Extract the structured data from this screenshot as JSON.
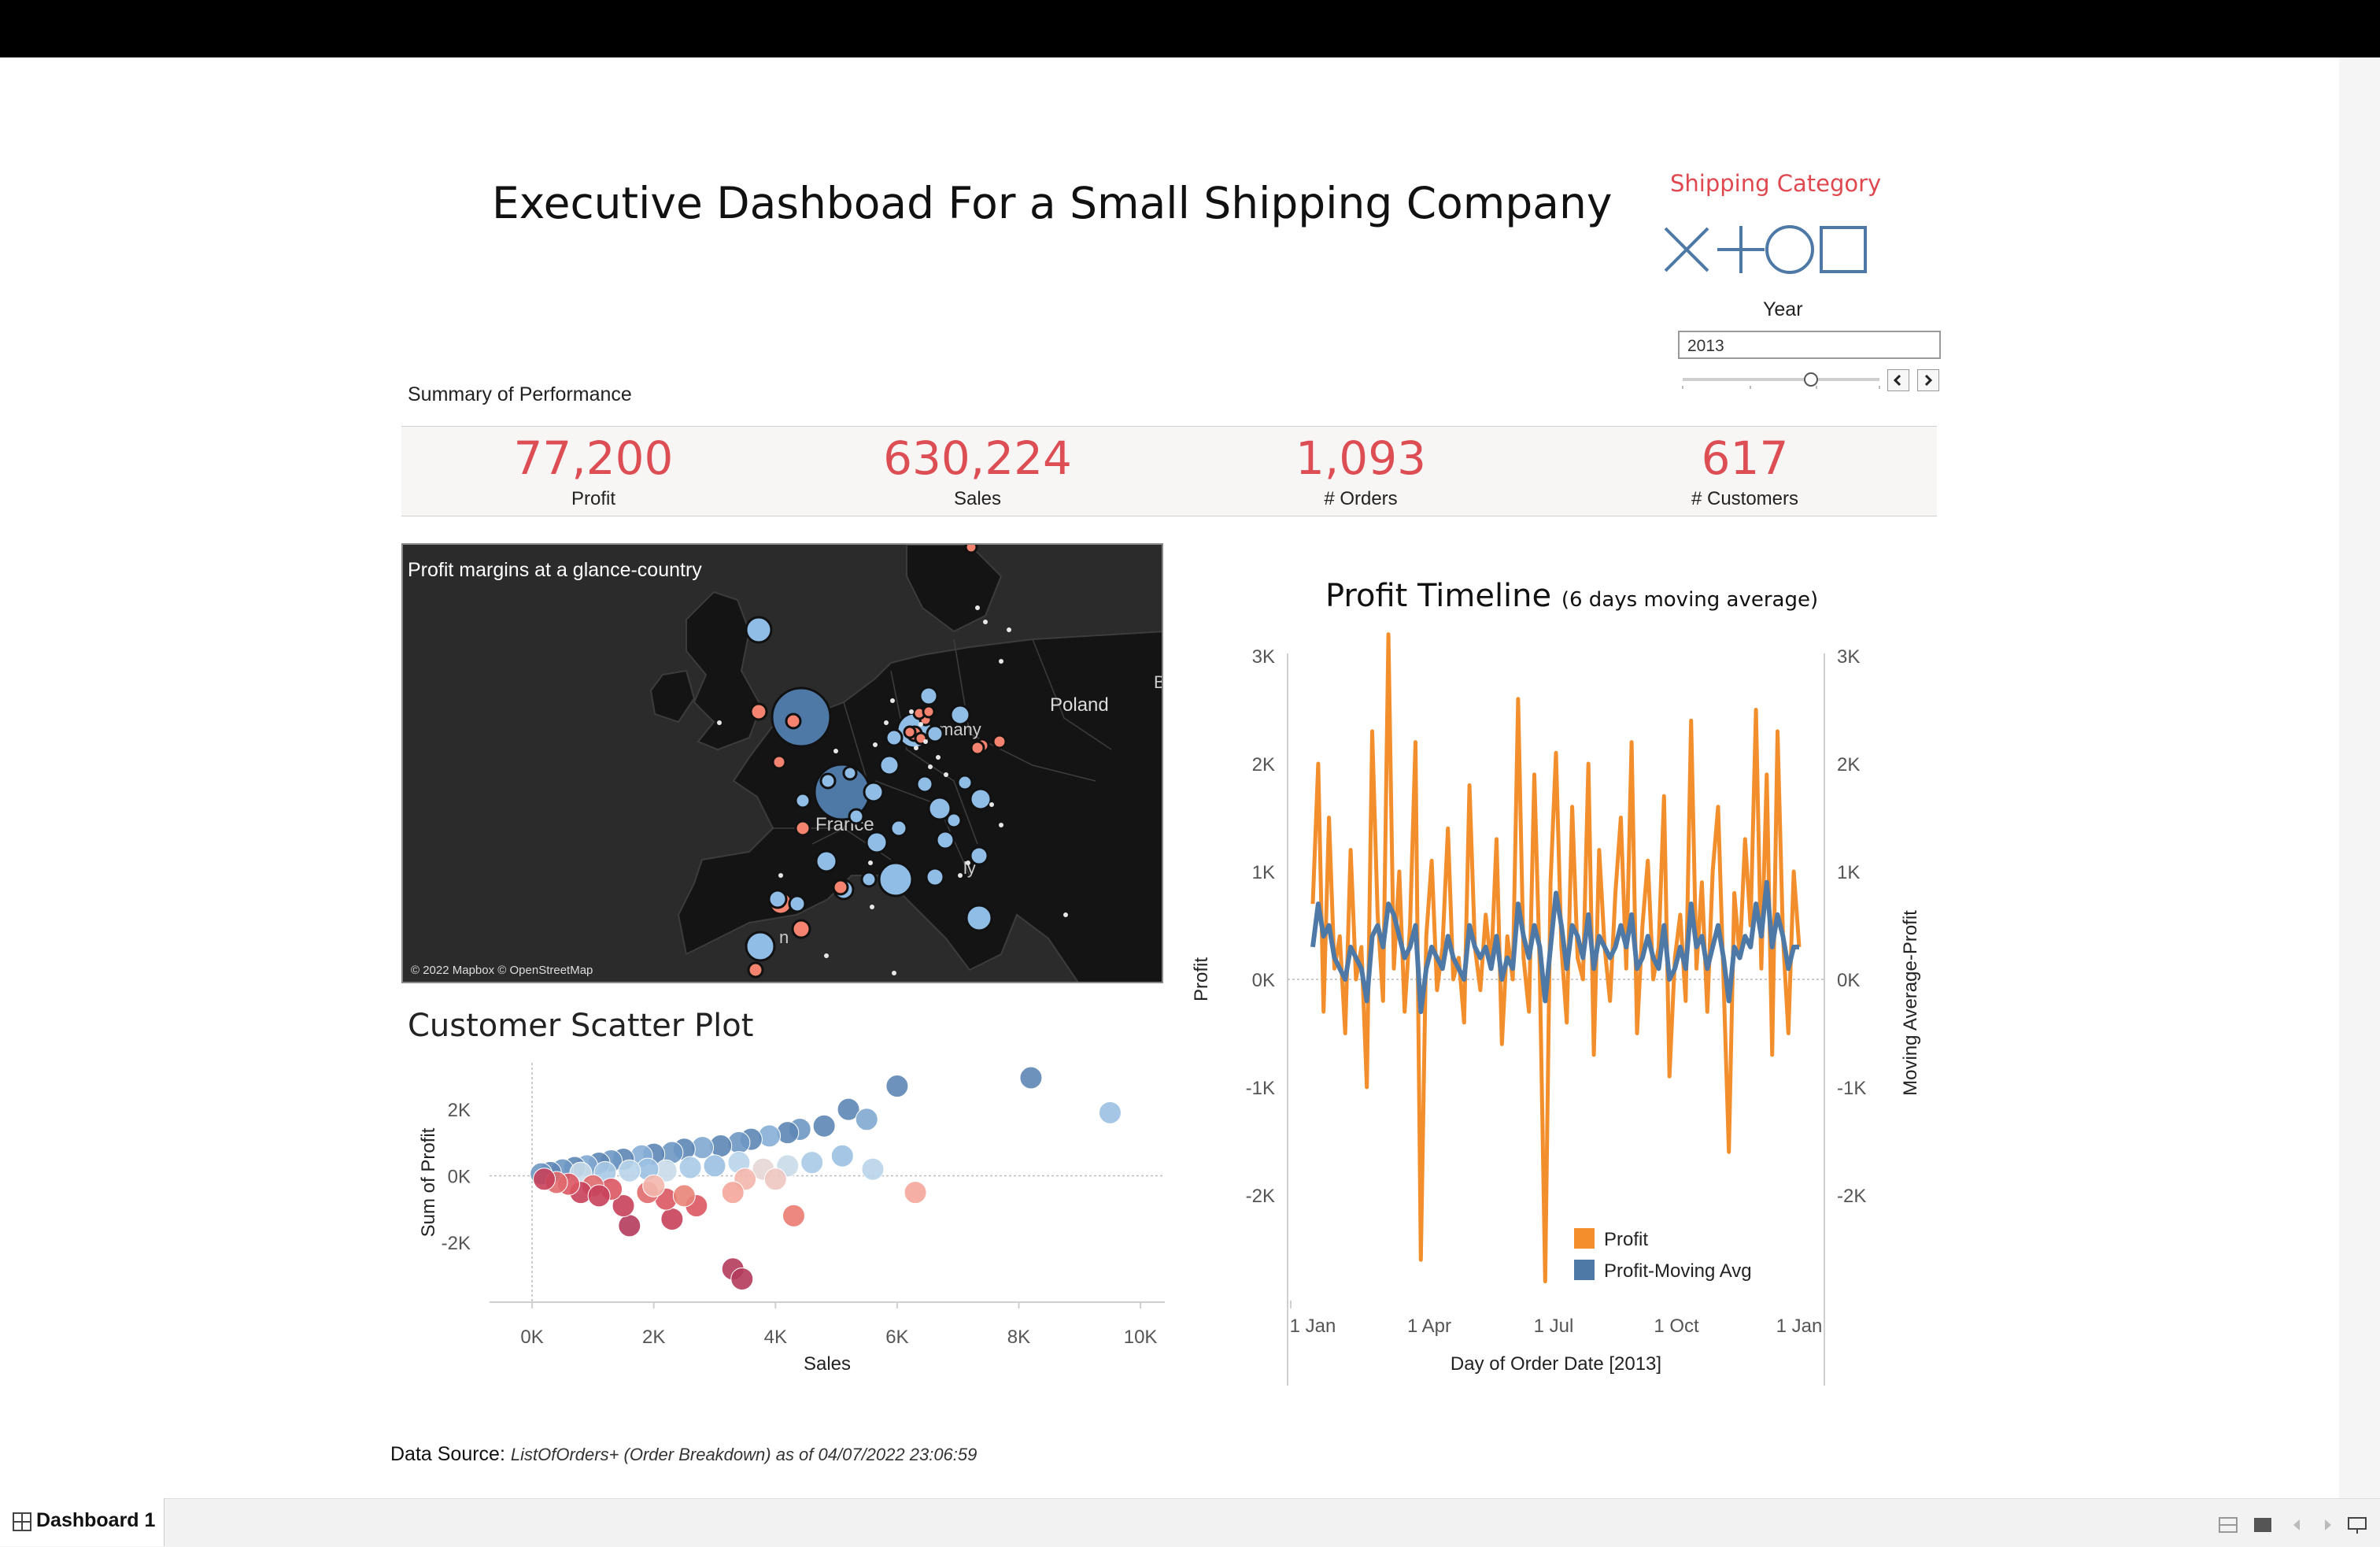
{
  "header": {
    "title": "Executive Dashboad For a Small Shipping Company"
  },
  "filters": {
    "shipping_category_label": "Shipping Category",
    "shipping_icons": [
      "x-shape-icon",
      "plus-shape-icon",
      "circle-shape-icon",
      "square-shape-icon"
    ],
    "year_label": "Year",
    "year_value": "2013"
  },
  "summary": {
    "label": "Summary of Performance",
    "kpis": [
      {
        "value": "77,200",
        "label": "Profit"
      },
      {
        "value": "630,224",
        "label": "Sales"
      },
      {
        "value": "1,093",
        "label": "# Orders"
      },
      {
        "value": "617",
        "label": "# Customers"
      }
    ]
  },
  "map": {
    "title": "Profit margins at a glance-country",
    "place_labels": [
      "Poland",
      "many",
      "France",
      "ly",
      "n",
      "B"
    ],
    "credit": "© 2022 Mapbox © OpenStreetMap"
  },
  "scatter": {
    "title": "Customer Scatter Plot"
  },
  "timeline": {
    "title": "Profit Timeline",
    "subtitle": "(6 days moving average)"
  },
  "footer": {
    "data_source_label": "Data Source:",
    "data_source_value": "ListOfOrders+ (Order Breakdown) as of 04/07/2022 23:06:59"
  },
  "tabs": {
    "active": "Dashboard 1"
  },
  "colors": {
    "kpi_red": "#dd4e54",
    "profit_orange": "#f28e2b",
    "moving_avg_blue": "#4e79a7",
    "map_background": "#2b2b2b"
  },
  "chart_data": [
    {
      "type": "scatter",
      "title": "Customer Scatter Plot",
      "xlabel": "Sales",
      "ylabel": "Sum of Profit",
      "xlim": [
        -700,
        10400
      ],
      "ylim": [
        -3800,
        3400
      ],
      "x_ticks": [
        "0K",
        "2K",
        "4K",
        "6K",
        "8K",
        "10K"
      ],
      "y_ticks": [
        "2K",
        "0K",
        "-2K"
      ],
      "points": [
        {
          "x": 8200,
          "y": 2950,
          "c": "#5d86b5"
        },
        {
          "x": 9500,
          "y": 1900,
          "c": "#9bc1e2"
        },
        {
          "x": 6000,
          "y": 2700,
          "c": "#5d86b5"
        },
        {
          "x": 5200,
          "y": 2000,
          "c": "#5d86b5"
        },
        {
          "x": 5500,
          "y": 1700,
          "c": "#7fa8d0"
        },
        {
          "x": 4800,
          "y": 1500,
          "c": "#5d86b5"
        },
        {
          "x": 4400,
          "y": 1400,
          "c": "#6e98c4"
        },
        {
          "x": 4200,
          "y": 1300,
          "c": "#5d86b5"
        },
        {
          "x": 3900,
          "y": 1200,
          "c": "#86afd6"
        },
        {
          "x": 3600,
          "y": 1100,
          "c": "#5d86b5"
        },
        {
          "x": 3400,
          "y": 1000,
          "c": "#6e98c4"
        },
        {
          "x": 3100,
          "y": 900,
          "c": "#5d86b5"
        },
        {
          "x": 2800,
          "y": 850,
          "c": "#7fa8d0"
        },
        {
          "x": 2500,
          "y": 800,
          "c": "#5d86b5"
        },
        {
          "x": 2300,
          "y": 700,
          "c": "#6e98c4"
        },
        {
          "x": 2000,
          "y": 650,
          "c": "#5d86b5"
        },
        {
          "x": 1800,
          "y": 600,
          "c": "#86afd6"
        },
        {
          "x": 1500,
          "y": 500,
          "c": "#5d86b5"
        },
        {
          "x": 1300,
          "y": 450,
          "c": "#6e98c4"
        },
        {
          "x": 1100,
          "y": 380,
          "c": "#5d86b5"
        },
        {
          "x": 900,
          "y": 300,
          "c": "#7fa8d0"
        },
        {
          "x": 700,
          "y": 250,
          "c": "#5d86b5"
        },
        {
          "x": 500,
          "y": 180,
          "c": "#6e98c4"
        },
        {
          "x": 300,
          "y": 100,
          "c": "#5d86b5"
        },
        {
          "x": 150,
          "y": 60,
          "c": "#6e98c4"
        },
        {
          "x": 5600,
          "y": 200,
          "c": "#b9d4ea"
        },
        {
          "x": 5100,
          "y": 600,
          "c": "#9bc1e2"
        },
        {
          "x": 4600,
          "y": 400,
          "c": "#a8cae6"
        },
        {
          "x": 4200,
          "y": 300,
          "c": "#c9dbe9"
        },
        {
          "x": 3800,
          "y": 200,
          "c": "#e6d6d4"
        },
        {
          "x": 3400,
          "y": 400,
          "c": "#b9d4ea"
        },
        {
          "x": 3000,
          "y": 300,
          "c": "#9bc1e2"
        },
        {
          "x": 2600,
          "y": 250,
          "c": "#a8cae6"
        },
        {
          "x": 2200,
          "y": 150,
          "c": "#c9dbe9"
        },
        {
          "x": 1900,
          "y": 200,
          "c": "#9bc1e2"
        },
        {
          "x": 1600,
          "y": 150,
          "c": "#b9d4ea"
        },
        {
          "x": 1200,
          "y": 100,
          "c": "#a8cae6"
        },
        {
          "x": 800,
          "y": 80,
          "c": "#c9dbe9"
        },
        {
          "x": 6300,
          "y": -500,
          "c": "#f4a69a"
        },
        {
          "x": 4300,
          "y": -1200,
          "c": "#ea7b72"
        },
        {
          "x": 4000,
          "y": -100,
          "c": "#eec7c1"
        },
        {
          "x": 3500,
          "y": -100,
          "c": "#f3b7ad"
        },
        {
          "x": 3300,
          "y": -2800,
          "c": "#b43b5b"
        },
        {
          "x": 3450,
          "y": -3100,
          "c": "#b43b5b"
        },
        {
          "x": 3300,
          "y": -500,
          "c": "#f4a69a"
        },
        {
          "x": 2700,
          "y": -900,
          "c": "#dc5662"
        },
        {
          "x": 2300,
          "y": -1300,
          "c": "#c7405a"
        },
        {
          "x": 2200,
          "y": -700,
          "c": "#dc5662"
        },
        {
          "x": 1900,
          "y": -500,
          "c": "#e06a6d"
        },
        {
          "x": 1600,
          "y": -1500,
          "c": "#b43b5b"
        },
        {
          "x": 1500,
          "y": -900,
          "c": "#c7405a"
        },
        {
          "x": 1300,
          "y": -400,
          "c": "#dc5662"
        },
        {
          "x": 1000,
          "y": -300,
          "c": "#e06a6d"
        },
        {
          "x": 800,
          "y": -500,
          "c": "#c7405a"
        },
        {
          "x": 600,
          "y": -250,
          "c": "#dc5662"
        },
        {
          "x": 400,
          "y": -200,
          "c": "#e06a6d"
        },
        {
          "x": 200,
          "y": -100,
          "c": "#c7405a"
        },
        {
          "x": 2500,
          "y": -600,
          "c": "#e88478"
        },
        {
          "x": 2000,
          "y": -300,
          "c": "#f3b7ad"
        },
        {
          "x": 1100,
          "y": -600,
          "c": "#c7405a"
        }
      ]
    },
    {
      "type": "line",
      "title": "Profit Timeline",
      "subtitle": "(6 days moving average)",
      "xlabel": "Day of Order Date [2013]",
      "ylabel": "Profit",
      "y2label": "Moving Average-Profit",
      "x_ticks": [
        "1 Jan",
        "1 Apr",
        "1 Jul",
        "1 Oct",
        "1 Jan"
      ],
      "y_ticks": [
        "3K",
        "2K",
        "1K",
        "0K",
        "-1K",
        "-2K"
      ],
      "ylim": [
        -3000,
        3000
      ],
      "legend": [
        {
          "name": "Profit",
          "color": "#f28e2b"
        },
        {
          "name": "Profit-Moving Avg",
          "color": "#4e79a7"
        }
      ],
      "series": [
        {
          "name": "Profit",
          "color": "#f28e2b",
          "values": [
            700,
            2000,
            -300,
            1500,
            100,
            400,
            -500,
            1200,
            0,
            300,
            -1000,
            2300,
            600,
            -200,
            3200,
            100,
            1000,
            -300,
            500,
            2200,
            -2600,
            400,
            1100,
            -100,
            300,
            1400,
            0,
            200,
            -400,
            1800,
            300,
            -100,
            600,
            100,
            1300,
            -600,
            400,
            0,
            2600,
            200,
            -300,
            1900,
            100,
            -2800,
            900,
            2100,
            300,
            -400,
            1600,
            200,
            0,
            2000,
            -700,
            1200,
            300,
            -200,
            800,
            1500,
            100,
            2200,
            -500,
            500,
            1100,
            0,
            300,
            1700,
            -900,
            200,
            600,
            -200,
            2400,
            100,
            900,
            -300,
            1000,
            1600,
            0,
            -1600,
            800,
            200,
            1300,
            500,
            2500,
            100,
            1900,
            -700,
            2300,
            400,
            -500,
            1000,
            300
          ]
        },
        {
          "name": "Profit-Moving Avg",
          "color": "#4e79a7",
          "values": [
            300,
            700,
            400,
            500,
            200,
            100,
            0,
            300,
            200,
            100,
            -200,
            400,
            500,
            300,
            700,
            600,
            400,
            200,
            300,
            500,
            -300,
            100,
            300,
            200,
            100,
            400,
            200,
            100,
            0,
            500,
            300,
            200,
            300,
            100,
            400,
            0,
            200,
            100,
            700,
            400,
            200,
            500,
            300,
            -200,
            300,
            800,
            500,
            100,
            500,
            400,
            200,
            600,
            100,
            400,
            300,
            200,
            300,
            500,
            300,
            600,
            100,
            200,
            400,
            200,
            100,
            500,
            0,
            100,
            300,
            100,
            700,
            300,
            400,
            100,
            300,
            500,
            200,
            -200,
            300,
            200,
            400,
            300,
            700,
            400,
            900,
            300,
            600,
            400,
            100,
            300,
            300
          ]
        }
      ]
    }
  ]
}
